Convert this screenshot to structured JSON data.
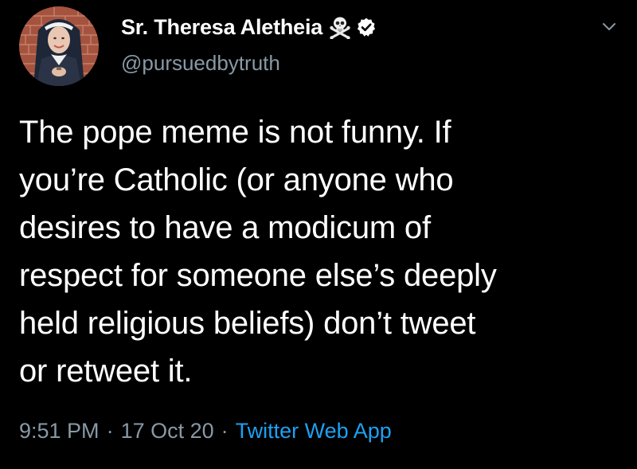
{
  "author": {
    "display_name": "Sr. Theresa Aletheia",
    "handle": "@pursuedbytruth",
    "name_emoji": "skull-crossbones-icon",
    "verified": true
  },
  "tweet": {
    "text": "The pope meme is not funny. If\nyou’re Catholic (or anyone who\ndesires to have a modicum of\nrespect for someone else’s deeply\nheld religious beliefs) don’t tweet\nor retweet it.",
    "time": "9:51 PM",
    "date": "17 Oct 20",
    "separator": "·",
    "source": "Twitter Web App"
  },
  "colors": {
    "background": "#000000",
    "text_primary": "#ffffff",
    "text_secondary": "#8899a6",
    "link": "#1da1f2"
  }
}
